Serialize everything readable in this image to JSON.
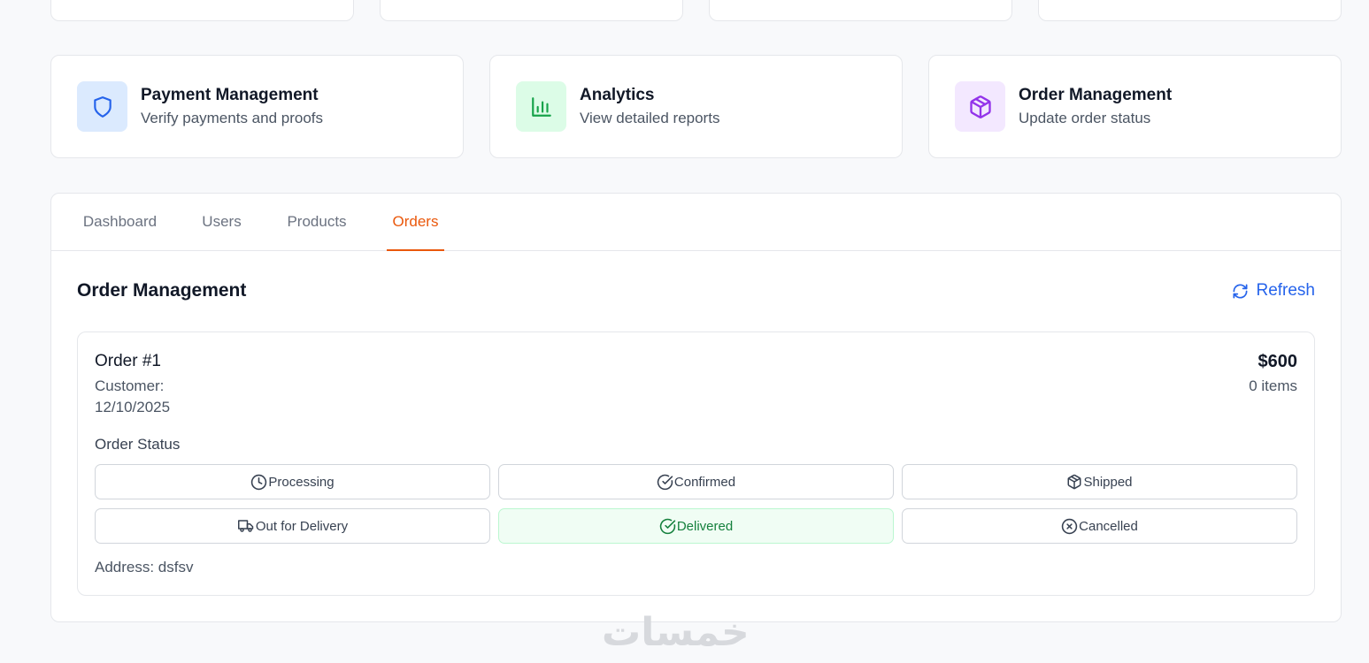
{
  "feature_cards": [
    {
      "title": "Payment Management",
      "description": "Verify payments and proofs",
      "icon": "shield-icon",
      "icon_bg": "#dbeafe",
      "icon_color": "#2563eb"
    },
    {
      "title": "Analytics",
      "description": "View detailed reports",
      "icon": "bar-chart-icon",
      "icon_bg": "#dcfce7",
      "icon_color": "#16a34a"
    },
    {
      "title": "Order Management",
      "description": "Update order status",
      "icon": "package-icon",
      "icon_bg": "#f3e8ff",
      "icon_color": "#9333ea"
    }
  ],
  "tabs": [
    {
      "label": "Dashboard",
      "active": false
    },
    {
      "label": "Users",
      "active": false
    },
    {
      "label": "Products",
      "active": false
    },
    {
      "label": "Orders",
      "active": true
    }
  ],
  "section": {
    "title": "Order Management",
    "refresh_label": "Refresh"
  },
  "order": {
    "id": "Order #1",
    "customer": "Customer:",
    "date": "12/10/2025",
    "total": "$600",
    "items": "0 items",
    "status_label": "Order Status",
    "status_options": [
      {
        "label": "Processing",
        "icon": "clock-icon",
        "selected": false
      },
      {
        "label": "Confirmed",
        "icon": "check-circle-icon",
        "selected": false
      },
      {
        "label": "Shipped",
        "icon": "package-icon",
        "selected": false
      },
      {
        "label": "Out for Delivery",
        "icon": "truck-icon",
        "selected": false
      },
      {
        "label": "Delivered",
        "icon": "check-circle-icon",
        "selected": true
      },
      {
        "label": "Cancelled",
        "icon": "x-circle-icon",
        "selected": false
      }
    ],
    "address": "Address: dsfsv"
  },
  "colors": {
    "accent": "#ea580c",
    "link": "#2563eb",
    "selected_bg": "#f0fdf4",
    "selected_text": "#15803d"
  },
  "watermark": "خمسات"
}
